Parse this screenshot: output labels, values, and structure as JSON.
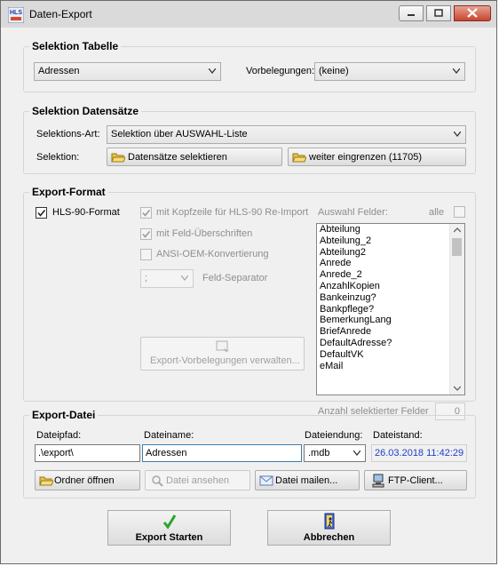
{
  "window": {
    "title": "Daten-Export",
    "app_icon_text": "HLS"
  },
  "selektion_tabelle": {
    "title": "Selektion Tabelle",
    "table_value": "Adressen",
    "vorbelegungen_label": "Vorbelegungen:",
    "vorbelegungen_value": "(keine)"
  },
  "selektion_datensaetze": {
    "title": "Selektion Datensätze",
    "art_label": "Selektions-Art:",
    "art_value": "Selektion über AUSWAHL-Liste",
    "selektion_label": "Selektion:",
    "btn_selektieren": "Datensätze selektieren",
    "btn_eingrenzen": "weiter eingrenzen (11705)"
  },
  "export_format": {
    "title": "Export-Format",
    "hls_label": "HLS-90-Format",
    "kopfzeile_label": "mit Kopfzeile für HLS-90 Re-Import",
    "feld_ueberschriften_label": "mit Feld-Überschriften",
    "ansi_label": "ANSI-OEM-Konvertierung",
    "separator_value": ";",
    "separator_label": "Feld-Separator",
    "btn_vorbelegungen": "Export-Vorbelegungen verwalten...",
    "auswahl_label": "Auswahl Felder:",
    "alle_label": "alle",
    "felder": [
      "Abteilung",
      "Abteilung_2",
      "Abteilung2",
      "Anrede",
      "Anrede_2",
      "AnzahlKopien",
      "Bankeinzug?",
      "Bankpflege?",
      "BemerkungLang",
      "BriefAnrede",
      "DefaultAdresse?",
      "DefaultVK",
      "eMail"
    ],
    "anzahl_label": "Anzahl selektierter Felder",
    "anzahl_value": "0"
  },
  "export_datei": {
    "title": "Export-Datei",
    "dateipfad_label": "Dateipfad:",
    "dateipfad_value": ".\\export\\",
    "dateiname_label": "Dateiname:",
    "dateiname_value": "Adressen",
    "dateiendung_label": "Dateiendung:",
    "dateiendung_value": ".mdb",
    "dateistand_label": "Dateistand:",
    "dateistand_value": "26.03.2018 11:42:29",
    "btn_ordner": "Ordner öffnen",
    "btn_ansehen": "Datei ansehen",
    "btn_mailen": "Datei mailen...",
    "btn_ftp": "FTP-Client..."
  },
  "actions": {
    "start": "Export Starten",
    "abbrechen": "Abbrechen"
  },
  "colors": {
    "date_blue": "#1f3fc8",
    "start_check_green": "#2aa52a",
    "close_red": "#c8452f"
  }
}
